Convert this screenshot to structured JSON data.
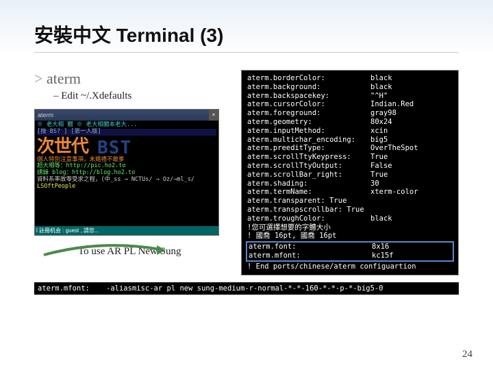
{
  "title": "安裝中文 Terminal (3)",
  "bullet1": "aterm",
  "bullet2": "Edit ~/.Xdefaults",
  "screenshot": {
    "app_title": "aterm",
    "line1": "※ 老大相 關 ※ 老大相關本老大...",
    "line2": "[按 BS? ] [第一人版]",
    "big_text": "次世代",
    "bst": "BST",
    "orange_line": "個人特別注意事項，未婚禮不敢爹",
    "green1": "超大相等：http://pic.ho2.to",
    "green2": "請錄 blog：http://blog.ho2.to",
    "white_line": "資料系率故零受求之程，(中_ss → NCTUs/ → Oz/→ml_s/",
    "yellow_line": "LSOftPeople",
    "status": "l 註冊机会 : guest , 請您..."
  },
  "caption": "To use AR PL New Sung",
  "config": [
    {
      "key": "aterm.borderColor:",
      "val": "black"
    },
    {
      "key": "aterm.background:",
      "val": "black"
    },
    {
      "key": "aterm.backspacekey:",
      "val": "\"^H\""
    },
    {
      "key": "aterm.cursorColor:",
      "val": "Indian.Red"
    },
    {
      "key": "aterm.foreground:",
      "val": "gray98"
    },
    {
      "key": "aterm.geometry:",
      "val": "80x24"
    },
    {
      "key": "aterm.inputMethod:",
      "val": "xcin"
    },
    {
      "key": "aterm.multichar_encoding:",
      "val": "big5"
    },
    {
      "key": "aterm.preeditType:",
      "val": "OverTheSpot"
    },
    {
      "key": "aterm.scrollTtyKeypress:",
      "val": "True"
    },
    {
      "key": "aterm.scrollTtyOutput:",
      "val": "False"
    },
    {
      "key": "aterm.scrollBar_right:",
      "val": "True"
    },
    {
      "key": "aterm.shading:",
      "val": "30"
    },
    {
      "key": "aterm.termName:",
      "val": "xterm-color"
    },
    {
      "key": "aterm.transparent: True",
      "val": ""
    },
    {
      "key": "aterm.transpscrollbar: True",
      "val": ""
    },
    {
      "key": "aterm.troughColor:",
      "val": "black"
    }
  ],
  "comment1": "!您可選擇想要的字體大小",
  "comment2": "! 國喬 16pt, 國喬 16pt",
  "config_hi": [
    {
      "key": "aterm.font:",
      "val": "8x16"
    },
    {
      "key": "aterm.mfont:",
      "val": "kc15f"
    }
  ],
  "comment3": "! End ports/chinese/aterm configuartion",
  "footnote_key": "aterm.mfont:",
  "footnote_val": "-aliasmisc-ar pl new sung-medium-r-normal-*-*-160-*-*-p-*-big5-0",
  "page_num": "24"
}
